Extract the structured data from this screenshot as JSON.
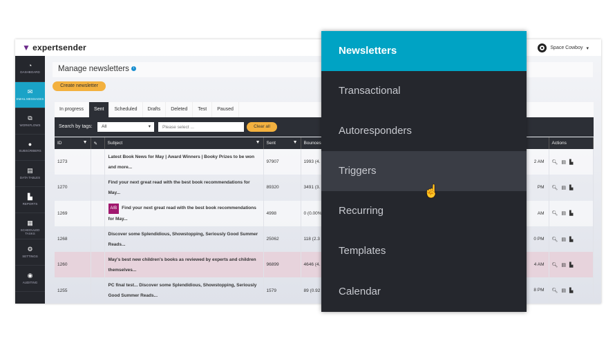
{
  "header": {
    "logo": "expertsender",
    "user": "Space Cowboy"
  },
  "sidebar": [
    {
      "label": "Dashboard",
      "icon": "dashboard-icon"
    },
    {
      "label": "Email messages",
      "icon": "envelope-icon",
      "active": true
    },
    {
      "label": "Workflows",
      "icon": "workflow-icon"
    },
    {
      "label": "Subscribers",
      "icon": "user-icon"
    },
    {
      "label": "Data tables",
      "icon": "database-icon"
    },
    {
      "label": "Reports",
      "icon": "chart-icon"
    },
    {
      "label": "Scheduled tasks",
      "icon": "calendar-icon"
    },
    {
      "label": "Settings",
      "icon": "gears-icon"
    },
    {
      "label": "Auditing",
      "icon": "eye-icon"
    }
  ],
  "page": {
    "title": "Manage newsletters",
    "create": "Create newsletter"
  },
  "tabs": [
    "In progress",
    "Sent",
    "Scheduled",
    "Drafts",
    "Deleted",
    "Test",
    "Paused"
  ],
  "filter": {
    "label": "Search by tags:",
    "select": "All",
    "placeholder": "Please select ...",
    "clear": "Clear all"
  },
  "columns": {
    "id": "ID",
    "subject": "Subject",
    "sent": "Sent",
    "bounces": "Bounces",
    "actions": "Actions"
  },
  "rows": [
    {
      "id": "1273",
      "subject": "Latest Book News for May | Award Winners | Booky Prizes to be won and more...",
      "sent": "97907",
      "bounces": "1993 (4.",
      "time": "2 AM"
    },
    {
      "id": "1270",
      "subject": "Find your next great read with the best book recommendations for May...",
      "sent": "89320",
      "bounces": "3491 (3.",
      "time": "PM"
    },
    {
      "id": "1269",
      "badge": "A/B",
      "subject": "Find your next great read with the best book recommendations for May...",
      "sent": "4998",
      "bounces": "0 (0.00%",
      "time": "AM"
    },
    {
      "id": "1268",
      "subject": "Discover some Splendidious, Showstopping, Seriously Good Summer Reads...",
      "sent": "25062",
      "bounces": "118 (2.3",
      "time": "0 PM"
    },
    {
      "id": "1260",
      "subject": "May's best new children's books as reviewed by experts and children themselves...",
      "sent": "96899",
      "bounces": "4646 (4.",
      "time": "4 AM"
    },
    {
      "id": "1255",
      "subject": "PC final test... Discover some Splendidious, Showstopping, Seriously Good Summer Reads...",
      "sent": "1579",
      "bounces": "89 (0.92",
      "time": "8 PM"
    }
  ],
  "menu": [
    "Newsletters",
    "Transactional",
    "Autoresponders",
    "Triggers",
    "Recurring",
    "Templates",
    "Calendar"
  ],
  "colors": {
    "accent": "#00a3c4",
    "orange": "#f3b13f",
    "dark": "#25272d"
  }
}
